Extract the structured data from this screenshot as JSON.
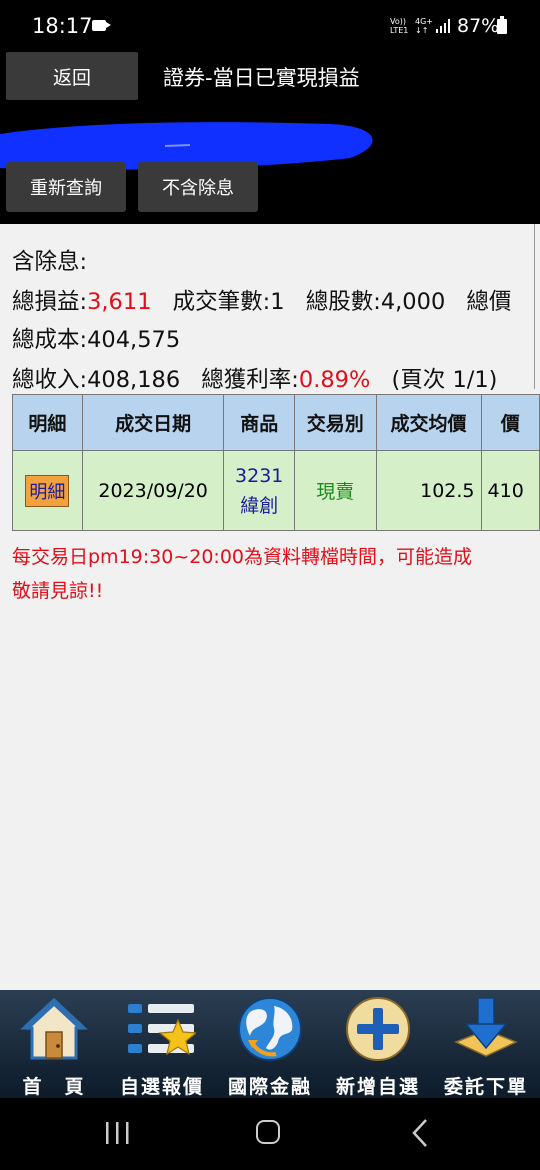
{
  "status_bar": {
    "time": "18:17",
    "net_top": "Vo)) 4G+",
    "net_bottom": "LTE1 ↓↑",
    "battery": "87%"
  },
  "header": {
    "back_label": "返回",
    "title": "證券-當日已實現損益",
    "query_label": "重新查詢",
    "no_dividend_label": "不含除息"
  },
  "summary": {
    "heading": "含除息:",
    "total_pl_label": "總損益:",
    "total_pl_value": "3,611",
    "trade_count_label": "成交筆數:",
    "trade_count_value": "1",
    "total_shares_label": "總股數:",
    "total_shares_value": "4,000",
    "total_price_label": "總價",
    "total_cost_label": "總成本:",
    "total_cost_value": "404,575",
    "total_income_label": "總收入:",
    "total_income_value": "408,186",
    "profit_rate_label": "總獲利率:",
    "profit_rate_value": "0.89%",
    "page_label": "(頁次 1/1)"
  },
  "table": {
    "headers": [
      "明細",
      "成交日期",
      "商品",
      "交易別",
      "成交均價",
      "價"
    ],
    "rows": [
      {
        "detail": "明細",
        "date": "2023/09/20",
        "code": "3231",
        "name": "緯創",
        "type": "現賣",
        "avg_price": "102.5",
        "price": "410"
      }
    ]
  },
  "notice": {
    "line1": "每交易日pm19:30~20:00為資料轉檔時間，可能造成",
    "line2": "敬請見諒!!"
  },
  "bottom_nav": [
    {
      "label": "首　頁",
      "icon": "home-icon"
    },
    {
      "label": "自選報價",
      "icon": "watchlist-icon"
    },
    {
      "label": "國際金融",
      "icon": "globe-icon"
    },
    {
      "label": "新增自選",
      "icon": "add-icon"
    },
    {
      "label": "委託下單",
      "icon": "order-icon"
    }
  ],
  "colors": {
    "accent_red": "#e0101a",
    "header_bg": "#b8d3ee",
    "row_bg": "#d5f0c8",
    "scribble": "#1030ff"
  }
}
